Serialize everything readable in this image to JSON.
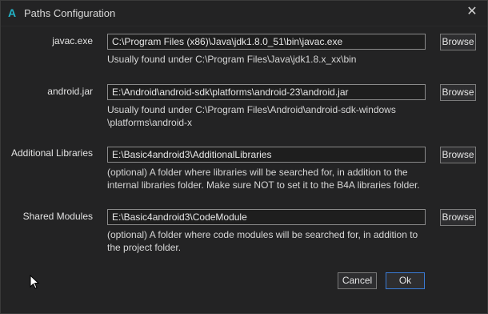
{
  "window": {
    "title": "Paths Configuration",
    "app_icon_letter": "A",
    "close_glyph": "✕"
  },
  "fields": [
    {
      "label": "javac.exe",
      "value": "C:\\Program Files (x86)\\Java\\jdk1.8.0_51\\bin\\javac.exe",
      "hint": "Usually found under C:\\Program Files\\Java\\jdk1.8.x_xx\\bin",
      "browse_label": "Browse"
    },
    {
      "label": "android.jar",
      "value": "E:\\Android\\android-sdk\\platforms\\android-23\\android.jar",
      "hint_line1": "Usually found under C:\\Program Files\\Android\\android-sdk-windows",
      "hint_line2": "\\platforms\\android-x",
      "browse_label": "Browse"
    },
    {
      "label": "Additional Libraries",
      "value": "E:\\Basic4android3\\AdditionalLibraries",
      "hint_line1": "(optional) A folder where libraries will be searched for, in addition to the",
      "hint_line2": "internal libraries folder. Make sure NOT to set it to the B4A libraries folder.",
      "browse_label": "Browse"
    },
    {
      "label": "Shared Modules",
      "value": "E:\\Basic4android3\\CodeModule",
      "hint_line1": "(optional) A folder where code modules will be searched for, in addition to",
      "hint_line2": "the project folder.",
      "browse_label": "Browse"
    }
  ],
  "buttons": {
    "cancel": "Cancel",
    "ok": "Ok"
  },
  "colors": {
    "background": "#232324",
    "accent": "#23b4c8",
    "ok_border": "#3a7bd5"
  }
}
